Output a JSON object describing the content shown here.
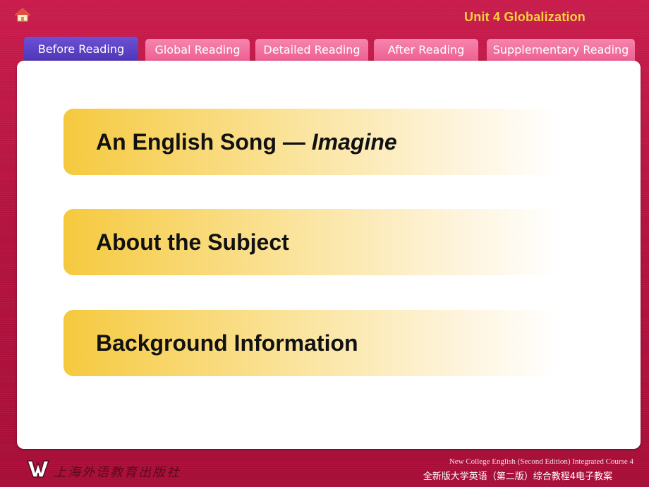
{
  "header": {
    "home_icon": "home-icon",
    "unit_title": "Unit 4 Globalization"
  },
  "tabs": [
    {
      "label": "Before Reading",
      "active": true
    },
    {
      "label": "Global Reading",
      "active": false
    },
    {
      "label": "Detailed Reading",
      "active": false
    },
    {
      "label": "After Reading",
      "active": false
    },
    {
      "label": "Supplementary Reading",
      "active": false
    }
  ],
  "menu": {
    "item1_prefix": "An English Song — ",
    "item1_italic": "Imagine",
    "item2": "About the Subject",
    "item3": "Background Information"
  },
  "footer": {
    "publisher": "上海外语教育出版社",
    "course_en": "New College English (Second Edition) Integrated Course 4",
    "course_cn": "全新版大学英语（第二版）综合教程4电子教案"
  },
  "colors": {
    "background": "#b3133f",
    "unit_title": "#f7d23a",
    "tab_inactive": "#ee5f91",
    "tab_active": "#4d34b6",
    "menu_gradient_start": "#f5c93e"
  }
}
